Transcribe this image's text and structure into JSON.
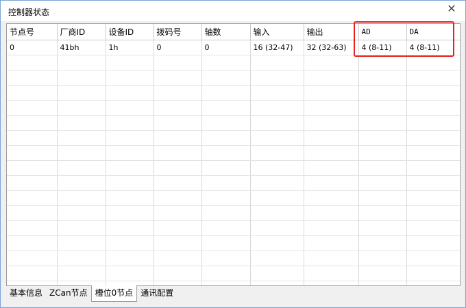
{
  "window": {
    "title": "控制器状态",
    "close_symbol": "✕"
  },
  "table": {
    "columns": [
      "节点号",
      "厂商ID",
      "设备ID",
      "拨码号",
      "轴数",
      "输入",
      "输出",
      "AD",
      "DA"
    ],
    "rows": [
      [
        "0",
        "41bh",
        "1h",
        "0",
        "0",
        "16 (32-47)",
        "32 (32-63)",
        "4 (8-11)",
        "4 (8-11)"
      ]
    ]
  },
  "highlight": {
    "color": "#e8231f",
    "covers": [
      "AD",
      "DA"
    ]
  },
  "tabs": [
    {
      "label": "基本信息",
      "active": false
    },
    {
      "label": "ZCan节点",
      "active": false
    },
    {
      "label": "槽位0节点",
      "active": true
    },
    {
      "label": "通讯配置",
      "active": false
    }
  ]
}
